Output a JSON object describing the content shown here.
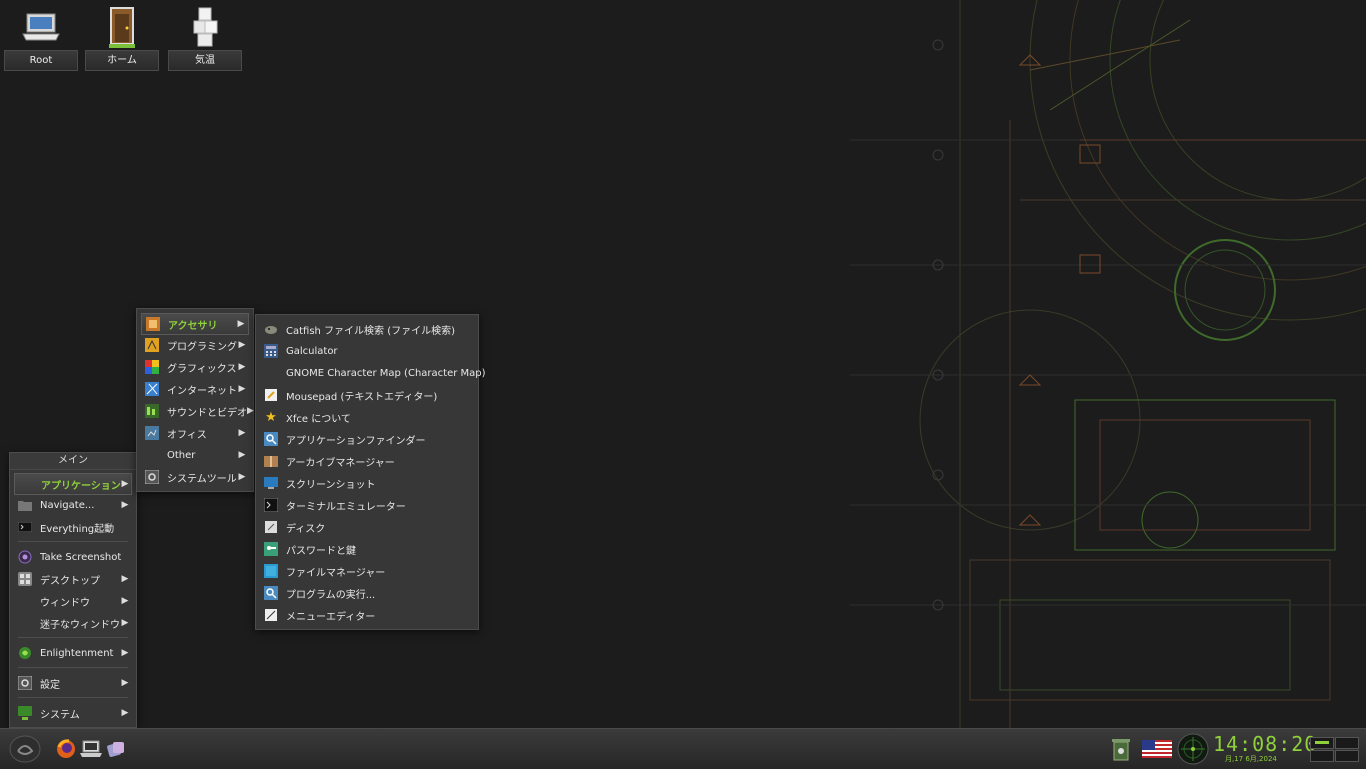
{
  "desktop_icons": [
    {
      "label": "Root",
      "icon": "computer-icon"
    },
    {
      "label": "ホーム",
      "icon": "door-icon"
    },
    {
      "label": "気温",
      "icon": "sugar-cube-icon"
    }
  ],
  "main_menu": {
    "title": "メイン",
    "items": [
      {
        "label": "アプリケーション",
        "icon": "none",
        "arrow": true
      },
      {
        "label": "Navigate...",
        "icon": "folder-icon",
        "arrow": true
      },
      {
        "label": "Everything起動",
        "icon": "terminal-icon",
        "arrow": false
      },
      {
        "label": "Take Screenshot",
        "icon": "camera-icon",
        "arrow": false
      },
      {
        "label": "デスクトップ",
        "icon": "desktop-icon",
        "arrow": true
      },
      {
        "label": "ウィンドウ",
        "icon": "none",
        "arrow": true
      },
      {
        "label": "迷子なウィンドウ",
        "icon": "none",
        "arrow": true
      },
      {
        "label": "Enlightenment",
        "icon": "enlightenment-icon",
        "arrow": true
      },
      {
        "label": "設定",
        "icon": "settings-icon",
        "arrow": true
      },
      {
        "label": "システム",
        "icon": "system-icon",
        "arrow": true
      }
    ]
  },
  "apps_menu": {
    "items": [
      {
        "label": "アクセサリ",
        "icon": "accessories-icon",
        "arrow": true
      },
      {
        "label": "プログラミング",
        "icon": "programming-icon",
        "arrow": true
      },
      {
        "label": "グラフィックス",
        "icon": "graphics-icon",
        "arrow": true
      },
      {
        "label": "インターネット",
        "icon": "internet-icon",
        "arrow": true
      },
      {
        "label": "サウンドとビデオ",
        "icon": "multimedia-icon",
        "arrow": true
      },
      {
        "label": "オフィス",
        "icon": "office-icon",
        "arrow": true
      },
      {
        "label": "Other",
        "icon": "none",
        "arrow": true
      },
      {
        "label": "システムツール",
        "icon": "system-tools-icon",
        "arrow": true
      }
    ]
  },
  "accessories_menu": {
    "items": [
      {
        "label": "Catfish ファイル検索 (ファイル検索)",
        "icon": "catfish-icon"
      },
      {
        "label": "Galculator",
        "icon": "calculator-icon"
      },
      {
        "label": "GNOME Character Map (Character Map)",
        "icon": "none"
      },
      {
        "label": "Mousepad (テキストエディター)",
        "icon": "text-editor-icon"
      },
      {
        "label": "Xfce について",
        "icon": "star-icon"
      },
      {
        "label": "アプリケーションファインダー",
        "icon": "app-finder-icon"
      },
      {
        "label": "アーカイブマネージャー",
        "icon": "archive-icon"
      },
      {
        "label": "スクリーンショット",
        "icon": "screenshot-icon"
      },
      {
        "label": "ターミナルエミュレーター",
        "icon": "terminal-icon"
      },
      {
        "label": "ディスク",
        "icon": "disk-icon"
      },
      {
        "label": "パスワードと鍵",
        "icon": "keys-icon"
      },
      {
        "label": "ファイルマネージャー",
        "icon": "file-manager-icon"
      },
      {
        "label": "プログラムの実行...",
        "icon": "run-icon"
      },
      {
        "label": "メニューエディター",
        "icon": "menu-editor-icon"
      }
    ]
  },
  "taskbar": {
    "launchers": [
      "start-icon",
      "firefox-icon",
      "files-icon",
      "apps-icon"
    ],
    "tray": [
      "trash-icon",
      "us-flag-icon",
      "radar-icon"
    ],
    "clock_time": "14:08:20",
    "clock_date": "月,17 6月,2024"
  },
  "colors": {
    "accent": "#8fd13a",
    "menu_bg": "#373737",
    "desktop_bg": "#1c1c1c"
  }
}
